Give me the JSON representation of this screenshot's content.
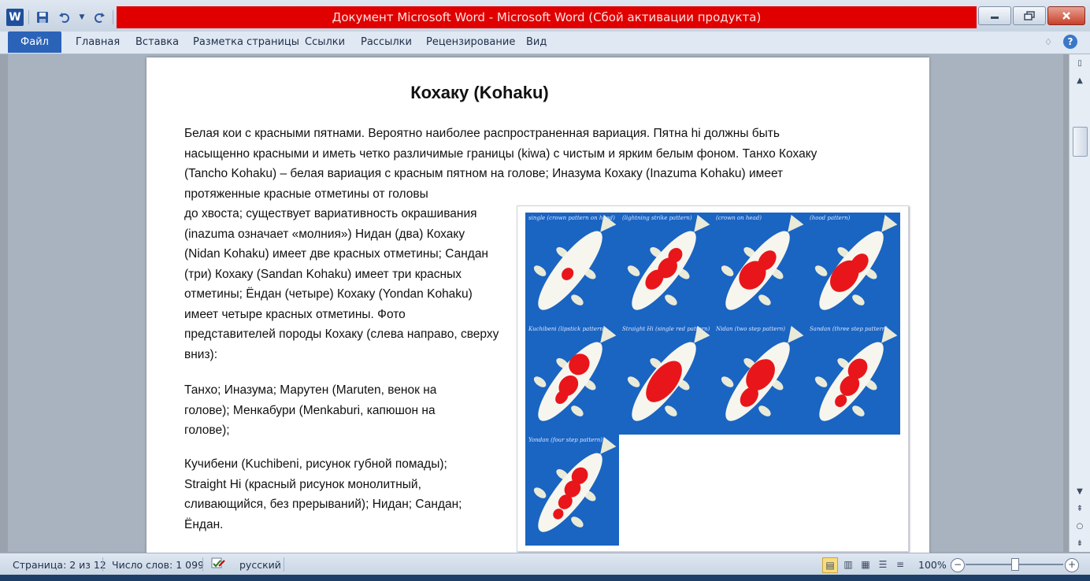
{
  "window": {
    "title": "Документ Microsoft Word  -  Microsoft Word (Сбой активации продукта)"
  },
  "qat": {
    "word_icon_letter": "W",
    "icons": [
      "word-icon",
      "save-icon",
      "undo-icon",
      "redo-icon",
      "customize-icon"
    ]
  },
  "ribbon": {
    "file_tab": "Файл",
    "tabs": [
      "Главная",
      "Вставка",
      "Разметка страницы",
      "Ссылки",
      "Рассылки",
      "Рецензирование",
      "Вид"
    ],
    "help": "?"
  },
  "document": {
    "title": "Кохаку (Kohaku)",
    "para_wide": "Белая кои с красными пятнами. Вероятно наиболее распространенная вариация. Пятна hi должны быть насыщенно красными и иметь четко различимые границы (kiwa) с чистым и ярким белым фоном. Танхо Кохаку (Tancho Kohaku) – белая вариация с красным пятном на голове; Иназума Кохаку (Inazuma Kohaku) имеет протяженные красные отметины от головы",
    "para_narrow": "до хвоста; существует вариативность окрашивания (inazuma означает «молния») Нидан (два) Кохаку (Nidan Kohaku) имеет две красных отметины; Сандан (три) Кохаку (Sandan Kohaku) имеет три красных отметины; Ёндан (четыре) Кохаку (Yondan Kohaku) имеет четыре красных отметины.            Фото представителей породы Кохаку (слева направо, сверху вниз):",
    "list1": "Танхо;  Иназума;  Марутен (Maruten,  венок на голове);  Менкабури (Menkaburi,  капюшон на голове);",
    "list2": "Кучибени (Kuchibeni,  рисунок губной помады); Straight Hi (красный рисунок монолитный, сливающийся, без прерываний);  Нидан; Сандан; Ёндан."
  },
  "figure": {
    "cells": [
      {
        "caption": "single (crown pattern on head)"
      },
      {
        "caption": "(lightning strike pattern)"
      },
      {
        "caption": "(crown on head)"
      },
      {
        "caption": "(hood pattern)"
      },
      {
        "caption": "Kuchibeni (lipstick pattern)"
      },
      {
        "caption": "Straight Hi (single red pattern)"
      },
      {
        "caption": "Nidan (two step pattern)"
      },
      {
        "caption": "Sandan (three step pattern)"
      },
      {
        "caption": "Yondan (four step pattern)"
      }
    ]
  },
  "status": {
    "page": "Страница: 2 из 12",
    "words": "Число слов: 1 099",
    "language": "русский",
    "zoom": "100%",
    "zoom_level_percent": 100
  },
  "colors": {
    "title_bar_red": "#e00000",
    "file_tab_blue": "#2a63b8",
    "koi_background": "#1a64c2",
    "koi_red": "#e8161b"
  }
}
